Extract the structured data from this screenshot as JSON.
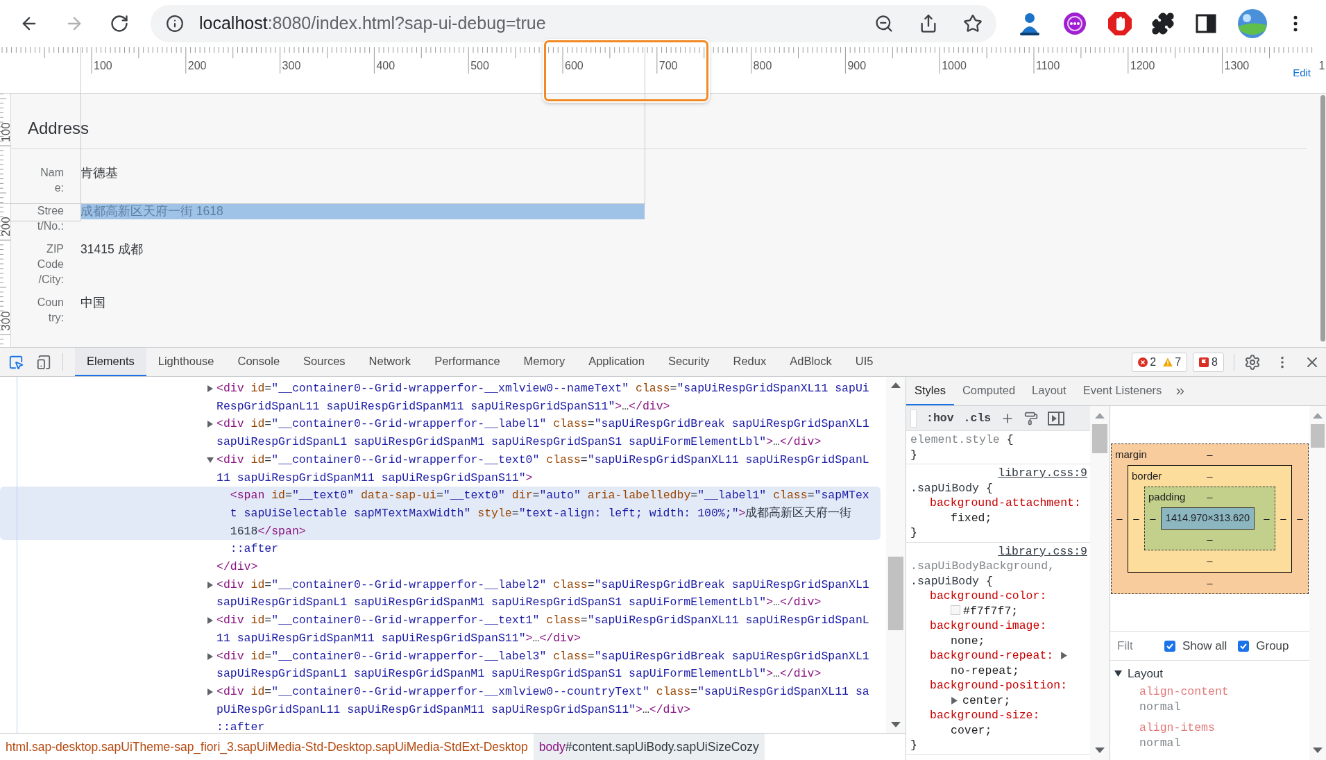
{
  "browser": {
    "nav": [
      {
        "kind": "back",
        "disabled": false
      },
      {
        "kind": "forward",
        "disabled": true
      },
      {
        "kind": "reload",
        "disabled": false
      }
    ],
    "address": {
      "host": "localhost",
      "path": ":8080/index.html?sap-ui-debug=true"
    }
  },
  "ruler": {
    "x_labels": [
      "100",
      "200",
      "300",
      "400",
      "500",
      "600",
      "700",
      "800",
      "900",
      "1000",
      "1100",
      "1200",
      "1300",
      "1"
    ],
    "y_labels": [
      "100",
      "200",
      "300"
    ],
    "edit_link": "Edit"
  },
  "page": {
    "title": "Address",
    "rows": [
      {
        "label": "Name:",
        "value": "肯德基",
        "highlighted": false
      },
      {
        "label": "Street/No.:",
        "value": "成都高新区天府一街 1618",
        "highlighted": true
      },
      {
        "label": "ZIP Code/City:",
        "value": "31415 成都",
        "highlighted": false
      },
      {
        "label": "Country:",
        "value": "中国",
        "highlighted": false
      }
    ]
  },
  "devtools": {
    "tabs": [
      {
        "label": "Elements",
        "selected": true
      },
      {
        "label": "Lighthouse",
        "selected": false
      },
      {
        "label": "Console",
        "selected": false
      },
      {
        "label": "Sources",
        "selected": false
      },
      {
        "label": "Network",
        "selected": false
      },
      {
        "label": "Performance",
        "selected": false
      },
      {
        "label": "Memory",
        "selected": false
      },
      {
        "label": "Application",
        "selected": false
      },
      {
        "label": "Security",
        "selected": false
      },
      {
        "label": "Redux",
        "selected": false
      },
      {
        "label": "AdBlock",
        "selected": false
      },
      {
        "label": "UI5",
        "selected": false
      }
    ],
    "badges": [
      {
        "kind": "error",
        "count": "2"
      },
      {
        "kind": "warning",
        "count": "7"
      },
      {
        "kind": "issue",
        "count": "8"
      }
    ]
  },
  "elements": {
    "nodes": [
      {
        "expanded": false,
        "selected": false,
        "tokens": [
          {
            "kind": "tag",
            "text": "<div"
          },
          {
            "kind": "attr",
            "text": " id"
          },
          {
            "kind": "eq",
            "text": "="
          },
          {
            "kind": "val",
            "text": "\"__container0--Grid-wrapperfor-__xmlview0--nameText\""
          },
          {
            "kind": "attr",
            "text": " class"
          },
          {
            "kind": "eq",
            "text": "="
          },
          {
            "kind": "val",
            "text": "\"sapUiRespGridSpanXL11 sapUiRespGridSpanL11 sapUiRespGridSpanM11 sapUiRespGridSpanS11\""
          },
          {
            "kind": "tag",
            "text": ">"
          },
          {
            "kind": "text",
            "text": "…"
          },
          {
            "kind": "tag",
            "text": "</div>"
          }
        ]
      },
      {
        "expanded": false,
        "selected": false,
        "tokens": [
          {
            "kind": "tag",
            "text": "<div"
          },
          {
            "kind": "attr",
            "text": " id"
          },
          {
            "kind": "eq",
            "text": "="
          },
          {
            "kind": "val",
            "text": "\"__container0--Grid-wrapperfor-__label1\""
          },
          {
            "kind": "attr",
            "text": " class"
          },
          {
            "kind": "eq",
            "text": "="
          },
          {
            "kind": "val",
            "text": "\"sapUiRespGridBreak sapUiRespGridSpanXL1 sapUiRespGridSpanL1 sapUiRespGridSpanM1 sapUiRespGridSpanS1 sapUiFormElementLbl\""
          },
          {
            "kind": "tag",
            "text": ">"
          },
          {
            "kind": "text",
            "text": "…"
          },
          {
            "kind": "tag",
            "text": "</div>"
          }
        ]
      },
      {
        "expanded": true,
        "selected": false,
        "tokens": [
          {
            "kind": "tag",
            "text": "<div"
          },
          {
            "kind": "attr",
            "text": " id"
          },
          {
            "kind": "eq",
            "text": "="
          },
          {
            "kind": "val",
            "text": "\"__container0--Grid-wrapperfor-__text0\""
          },
          {
            "kind": "attr",
            "text": " class"
          },
          {
            "kind": "eq",
            "text": "="
          },
          {
            "kind": "val",
            "text": "\"sapUiRespGridSpanXL11 sapUiRespGridSpanL11 sapUiRespGridSpanM11 sapUiRespGridSpanS11\""
          },
          {
            "kind": "tag",
            "text": ">"
          }
        ],
        "close_tokens": [
          {
            "kind": "tag",
            "text": "</div>"
          }
        ],
        "children": [
          {
            "selected": true,
            "tokens": [
              {
                "kind": "tag",
                "text": "<span"
              },
              {
                "kind": "attr",
                "text": " id"
              },
              {
                "kind": "eq",
                "text": "="
              },
              {
                "kind": "val",
                "text": "\"__text0\""
              },
              {
                "kind": "attr",
                "text": " data-sap-ui"
              },
              {
                "kind": "eq",
                "text": "="
              },
              {
                "kind": "val",
                "text": "\"__text0\""
              },
              {
                "kind": "attr",
                "text": " dir"
              },
              {
                "kind": "eq",
                "text": "="
              },
              {
                "kind": "val",
                "text": "\"auto\""
              },
              {
                "kind": "attr",
                "text": " aria-labelledby"
              },
              {
                "kind": "eq",
                "text": "="
              },
              {
                "kind": "val",
                "text": "\"__label1\""
              },
              {
                "kind": "attr",
                "text": " class"
              },
              {
                "kind": "eq",
                "text": "="
              },
              {
                "kind": "val",
                "text": "\"sapMText sapUiSelectable sapMTextMaxWidth\""
              },
              {
                "kind": "attr",
                "text": " style"
              },
              {
                "kind": "eq",
                "text": "="
              },
              {
                "kind": "val",
                "text": "\"text-align: left; width: 100%;\""
              },
              {
                "kind": "tag",
                "text": ">"
              },
              {
                "kind": "text",
                "text": "成都高新区天府一街 1618"
              },
              {
                "kind": "tag",
                "text": "</span>"
              }
            ]
          },
          {
            "selected": false,
            "tokens": [
              {
                "kind": "pseudo",
                "text": "::after"
              }
            ]
          }
        ]
      },
      {
        "expanded": false,
        "selected": false,
        "tokens": [
          {
            "kind": "tag",
            "text": "<div"
          },
          {
            "kind": "attr",
            "text": " id"
          },
          {
            "kind": "eq",
            "text": "="
          },
          {
            "kind": "val",
            "text": "\"__container0--Grid-wrapperfor-__label2\""
          },
          {
            "kind": "attr",
            "text": " class"
          },
          {
            "kind": "eq",
            "text": "="
          },
          {
            "kind": "val",
            "text": "\"sapUiRespGridBreak sapUiRespGridSpanXL1 sapUiRespGridSpanL1 sapUiRespGridSpanM1 sapUiRespGridSpanS1 sapUiFormElementLbl\""
          },
          {
            "kind": "tag",
            "text": ">"
          },
          {
            "kind": "text",
            "text": "…"
          },
          {
            "kind": "tag",
            "text": "</div>"
          }
        ]
      },
      {
        "expanded": false,
        "selected": false,
        "tokens": [
          {
            "kind": "tag",
            "text": "<div"
          },
          {
            "kind": "attr",
            "text": " id"
          },
          {
            "kind": "eq",
            "text": "="
          },
          {
            "kind": "val",
            "text": "\"__container0--Grid-wrapperfor-__text1\""
          },
          {
            "kind": "attr",
            "text": " class"
          },
          {
            "kind": "eq",
            "text": "="
          },
          {
            "kind": "val",
            "text": "\"sapUiRespGridSpanXL11 sapUiRespGridSpanL11 sapUiRespGridSpanM11 sapUiRespGridSpanS11\""
          },
          {
            "kind": "tag",
            "text": ">"
          },
          {
            "kind": "text",
            "text": "…"
          },
          {
            "kind": "tag",
            "text": "</div>"
          }
        ]
      },
      {
        "expanded": false,
        "selected": false,
        "tokens": [
          {
            "kind": "tag",
            "text": "<div"
          },
          {
            "kind": "attr",
            "text": " id"
          },
          {
            "kind": "eq",
            "text": "="
          },
          {
            "kind": "val",
            "text": "\"__container0--Grid-wrapperfor-__label3\""
          },
          {
            "kind": "attr",
            "text": " class"
          },
          {
            "kind": "eq",
            "text": "="
          },
          {
            "kind": "val",
            "text": "\"sapUiRespGridBreak sapUiRespGridSpanXL1 sapUiRespGridSpanL1 sapUiRespGridSpanM1 sapUiRespGridSpanS1 sapUiFormElementLbl\""
          },
          {
            "kind": "tag",
            "text": ">"
          },
          {
            "kind": "text",
            "text": "…"
          },
          {
            "kind": "tag",
            "text": "</div>"
          }
        ]
      },
      {
        "expanded": false,
        "selected": false,
        "tokens": [
          {
            "kind": "tag",
            "text": "<div"
          },
          {
            "kind": "attr",
            "text": " id"
          },
          {
            "kind": "eq",
            "text": "="
          },
          {
            "kind": "val",
            "text": "\"__container0--Grid-wrapperfor-__xmlview0--countryText\""
          },
          {
            "kind": "attr",
            "text": " class"
          },
          {
            "kind": "eq",
            "text": "="
          },
          {
            "kind": "val",
            "text": "\"sapUiRespGridSpanXL11 sapUiRespGridSpanL11 sapUiRespGridSpanM11 sapUiRespGridSpanS11\""
          },
          {
            "kind": "tag",
            "text": ">"
          },
          {
            "kind": "text",
            "text": "…"
          },
          {
            "kind": "tag",
            "text": "</div>"
          }
        ]
      },
      {
        "selected": false,
        "tokens": [
          {
            "kind": "pseudo",
            "text": "::after"
          }
        ]
      }
    ]
  },
  "styles": {
    "tabs": [
      {
        "label": "Styles",
        "selected": true
      },
      {
        "label": "Computed",
        "selected": false
      },
      {
        "label": "Layout",
        "selected": false
      },
      {
        "label": "Event Listeners",
        "selected": false
      }
    ],
    "toolbar": {
      "hov": ":hov",
      "cls": ".cls"
    },
    "rules": [
      {
        "selectors": [
          {
            "text": "element.style",
            "matched": false
          }
        ],
        "open": "{",
        "close": "}"
      },
      {
        "selectors": [
          {
            "text": ".sapUiBody",
            "matched": true
          }
        ],
        "open": "{",
        "close": "}",
        "source": "library.css:9",
        "declarations": [
          {
            "kind": "plain",
            "name": "background-attachment:",
            "value": "fixed;",
            "expandable": false
          }
        ]
      },
      {
        "selectors": [
          {
            "text": ".sapUiBodyBackground,",
            "matched": false
          },
          {
            "text": ".sapUiBody",
            "matched": true
          }
        ],
        "open": "{",
        "close": "}",
        "source": "library.css:9",
        "declarations": [
          {
            "kind": "color",
            "name": "background-color:",
            "value": "#f7f7f7;",
            "expandable": false
          },
          {
            "kind": "plain",
            "name": "background-image:",
            "value": "none;",
            "expandable": false
          },
          {
            "kind": "plain",
            "name": "background-repeat:",
            "value": "no-repeat;",
            "expandable": true
          },
          {
            "kind": "plain",
            "name": "background-position:",
            "value": "center;",
            "expandable": true
          },
          {
            "kind": "plain",
            "name": "background-size:",
            "value": "cover;",
            "expandable": false
          }
        ]
      }
    ]
  },
  "box_model": {
    "margin": {
      "label": "margin",
      "top": "–",
      "right": "–",
      "bottom": "–",
      "left": "–"
    },
    "border": {
      "label": "border",
      "top": "–",
      "right": "–",
      "bottom": "–",
      "left": "–"
    },
    "padding": {
      "label": "padding",
      "top": "–",
      "right": "–",
      "bottom": "–",
      "left": "–"
    },
    "content": "1414.970×313.620"
  },
  "computed": {
    "filter_placeholder": "Filt",
    "options": [
      {
        "label": "Show all",
        "checked": true
      },
      {
        "label": "Group",
        "checked": true
      }
    ],
    "section": {
      "title": "Layout",
      "expanded": true,
      "properties": [
        {
          "name": "align-content",
          "value": "normal"
        },
        {
          "name": "align-items",
          "value": "normal"
        }
      ]
    }
  },
  "breadcrumbs": [
    {
      "tag": "html",
      "rest": ".sap-desktop.sapUiTheme-sap_fiori_3.sapUiMedia-Std-Desktop.sapUiMedia-StdExt-Desktop",
      "selected": false
    },
    {
      "tag": "body",
      "rest": "#content.sapUiBody.sapUiSizeCozy",
      "selected": true
    }
  ]
}
